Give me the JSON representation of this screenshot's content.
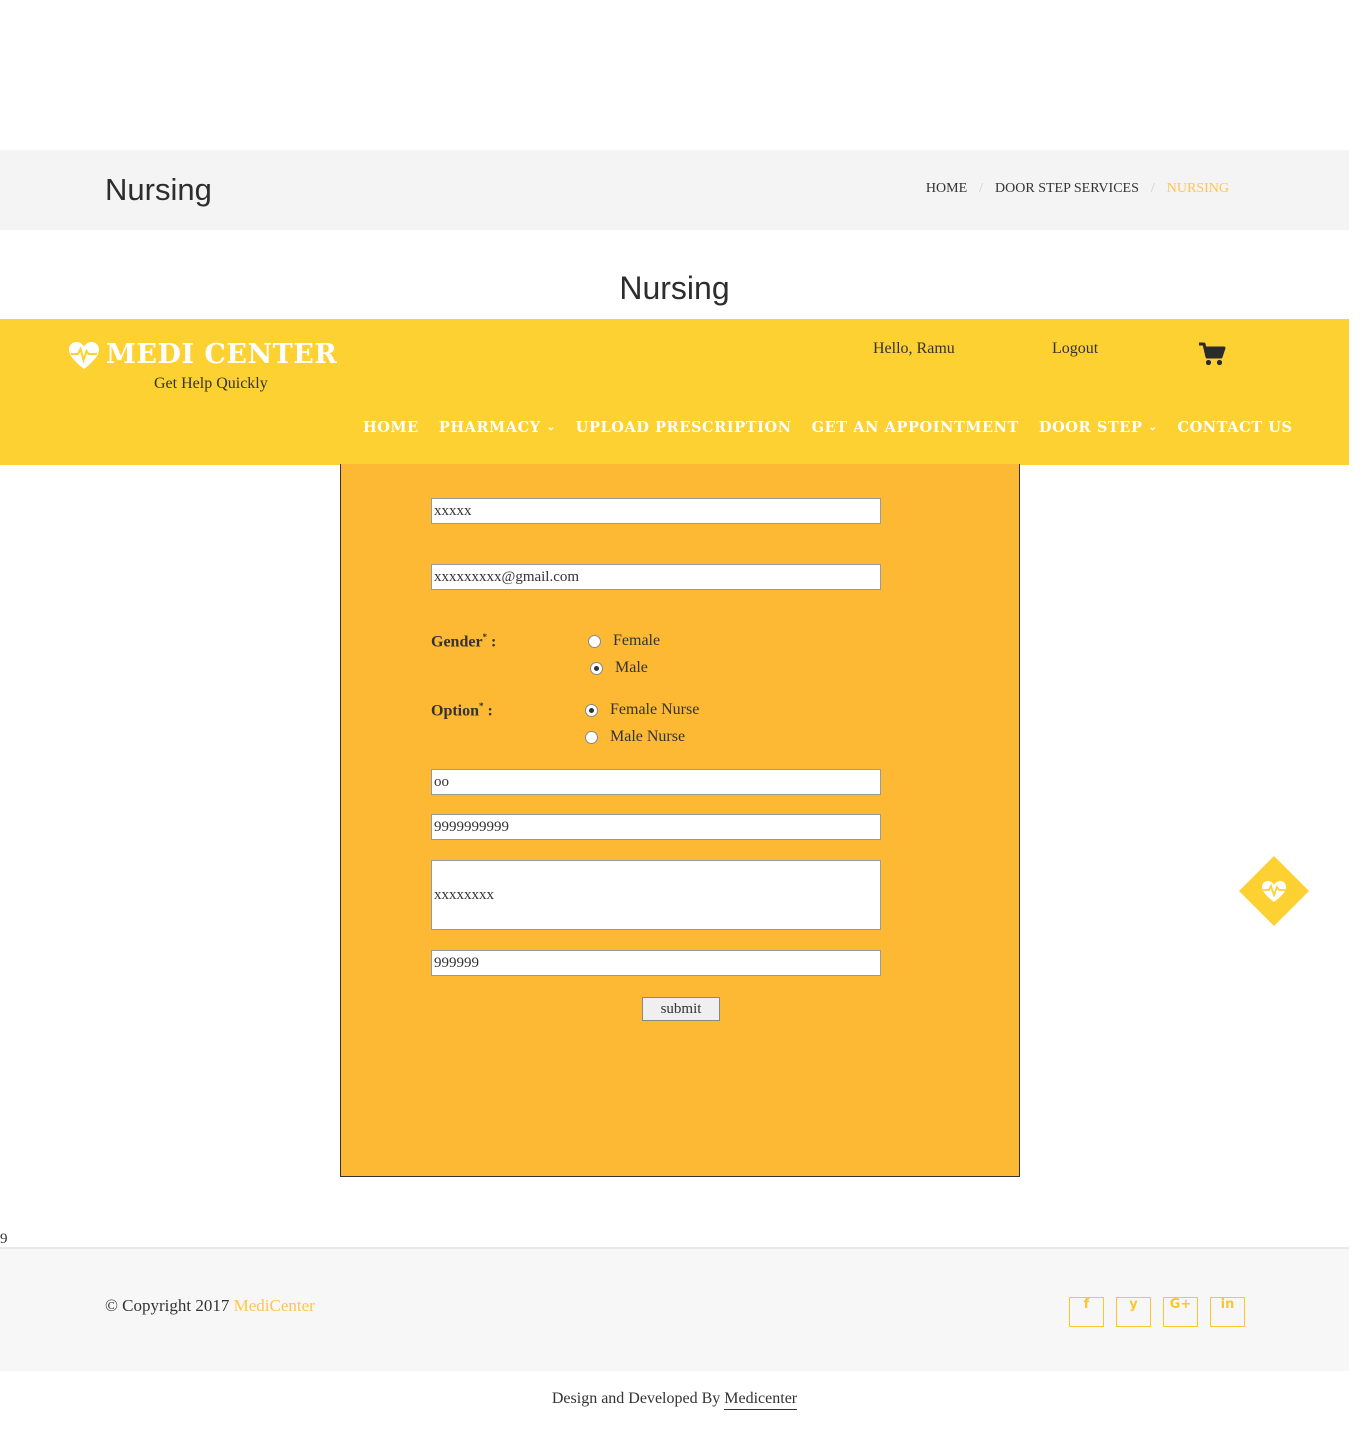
{
  "page_header": {
    "title": "Nursing",
    "breadcrumb": [
      "HOME",
      "DOOR STEP SERVICES",
      "NURSING"
    ],
    "breadcrumb_separator": "/"
  },
  "section_title": "Nursing",
  "header": {
    "brand": "MEDI CENTER",
    "tagline": "Get Help Quickly",
    "greeting": "Hello, Ramu",
    "logout": "Logout",
    "cart_icon": "shopping-cart-icon",
    "nav": [
      {
        "label": "HOME",
        "dropdown": false
      },
      {
        "label": "PHARMACY",
        "dropdown": true
      },
      {
        "label": "UPLOAD PRESCRIPTION",
        "dropdown": false
      },
      {
        "label": "GET AN APPOINTMENT",
        "dropdown": false
      },
      {
        "label": "DOOR STEP",
        "dropdown": true
      },
      {
        "label": "CONTACT US",
        "dropdown": false
      }
    ],
    "dropdown_glyph": "⌄"
  },
  "form": {
    "name_value": "xxxxx",
    "email_value": "xxxxxxxxx@gmail.com",
    "gender_label": "Gender",
    "required_mark": "*",
    "label_suffix": " :",
    "gender_options": [
      {
        "label": "Female",
        "selected": false
      },
      {
        "label": "Male",
        "selected": true
      }
    ],
    "option_label": "Option",
    "nurse_options": [
      {
        "label": "Female Nurse",
        "selected": true
      },
      {
        "label": "Male Nurse",
        "selected": false
      }
    ],
    "age_value": "oo",
    "phone_value": "9999999999",
    "address_value": "xxxxxxxx",
    "pincode_value": "999999",
    "submit_label": "submit"
  },
  "stray_text": "9",
  "footer": {
    "copyright_prefix": "© Copyright 2017",
    "copyright_brand": "MediCenter",
    "socials": [
      {
        "icon": "facebook-icon",
        "glyph": "f"
      },
      {
        "icon": "twitter-icon",
        "glyph": "y"
      },
      {
        "icon": "google-plus-icon",
        "glyph": "G+"
      },
      {
        "icon": "linkedin-icon",
        "glyph": "in"
      }
    ],
    "credit_prefix": "Design and Developed By",
    "credit_link": "Medicenter"
  },
  "colors": {
    "accent_yellow": "#fed132",
    "form_orange": "#fdb933",
    "link_gold": "#ffc54c"
  }
}
